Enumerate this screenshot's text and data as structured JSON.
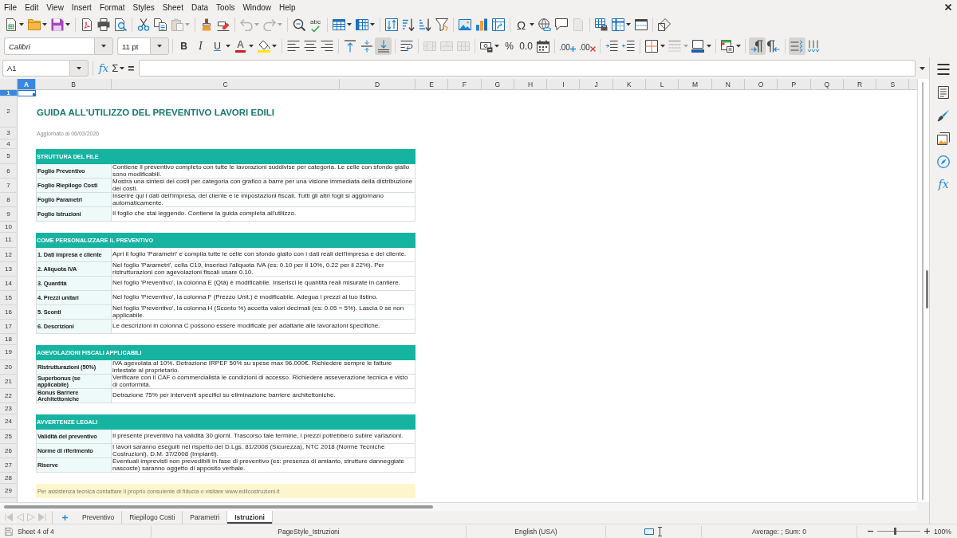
{
  "menu_bar": {
    "items": [
      "File",
      "Edit",
      "View",
      "Insert",
      "Format",
      "Styles",
      "Sheet",
      "Data",
      "Tools",
      "Window",
      "Help"
    ]
  },
  "standard_toolbar": {
    "spelling_label": "abc",
    "special_character_label": "Ω",
    "paste": {
      "disabled": true
    },
    "undo": {
      "disabled": true
    },
    "redo": {
      "disabled": true
    },
    "headers_footers": {
      "disabled": true
    }
  },
  "formatting_toolbar": {
    "font_name": "Calibri",
    "font_size": "11 pt",
    "bold_label": "B",
    "italic_label": "I",
    "underline_label": "U",
    "font_color_label": "A",
    "percent_label": "%",
    "number_label": "0.0",
    "add_decimal_label": ".00",
    "delete_decimal_label": ".00",
    "vertical_align": [
      {
        "selected": false
      },
      {
        "selected": false
      },
      {
        "selected": true
      }
    ],
    "merge_buttons": [
      {
        "disabled": true
      },
      {
        "disabled": true
      },
      {
        "disabled": true
      }
    ],
    "border_style": {
      "disabled": true
    },
    "paragraph_direction": [
      {
        "selected": true
      },
      {
        "selected": false
      }
    ],
    "text_orientation": [
      {
        "selected": true
      },
      {
        "selected": false
      }
    ]
  },
  "formula_bar": {
    "cell_reference": "A1",
    "function_wizard_label": "fx",
    "sum_label": "Σ",
    "formula_label": "="
  },
  "sidebar": {
    "functions_label": "fx"
  },
  "column_headers": [
    {
      "label": "A",
      "selected": true
    },
    {
      "label": "B",
      "selected": false
    },
    {
      "label": "C",
      "selected": false
    },
    {
      "label": "D",
      "selected": false
    },
    {
      "label": "E",
      "selected": false
    },
    {
      "label": "F",
      "selected": false
    },
    {
      "label": "G",
      "selected": false
    },
    {
      "label": "H",
      "selected": false
    },
    {
      "label": "I",
      "selected": false
    },
    {
      "label": "J",
      "selected": false
    },
    {
      "label": "K",
      "selected": false
    },
    {
      "label": "L",
      "selected": false
    },
    {
      "label": "M",
      "selected": false
    },
    {
      "label": "N",
      "selected": false
    },
    {
      "label": "O",
      "selected": false
    },
    {
      "label": "P",
      "selected": false
    },
    {
      "label": "Q",
      "selected": false
    },
    {
      "label": "R",
      "selected": false
    },
    {
      "label": "S",
      "selected": false
    }
  ],
  "row_headers": [
    {
      "label": "1",
      "selected": true
    },
    {
      "label": "2",
      "selected": false
    },
    {
      "label": "3",
      "selected": false
    },
    {
      "label": "4",
      "selected": false
    },
    {
      "label": "5",
      "selected": false
    },
    {
      "label": "6",
      "selected": false
    },
    {
      "label": "7",
      "selected": false
    },
    {
      "label": "8",
      "selected": false
    },
    {
      "label": "9",
      "selected": false
    },
    {
      "label": "10",
      "selected": false
    },
    {
      "label": "11",
      "selected": false
    },
    {
      "label": "12",
      "selected": false
    },
    {
      "label": "13",
      "selected": false
    },
    {
      "label": "14",
      "selected": false
    },
    {
      "label": "15",
      "selected": false
    },
    {
      "label": "16",
      "selected": false
    },
    {
      "label": "17",
      "selected": false
    },
    {
      "label": "18",
      "selected": false
    },
    {
      "label": "19",
      "selected": false
    },
    {
      "label": "20",
      "selected": false
    },
    {
      "label": "21",
      "selected": false
    },
    {
      "label": "22",
      "selected": false
    },
    {
      "label": "23",
      "selected": false
    },
    {
      "label": "24",
      "selected": false
    },
    {
      "label": "25",
      "selected": false
    },
    {
      "label": "26",
      "selected": false
    },
    {
      "label": "27",
      "selected": false
    },
    {
      "label": "28",
      "selected": false
    },
    {
      "label": "29",
      "selected": false
    }
  ],
  "sheet": {
    "title": "GUIDA ALL'UTILIZZO DEL PREVENTIVO LAVORI EDILI",
    "updated": "Aggiornato al 06/03/2026",
    "sections": [
      {
        "heading": "STRUTTURA DEL FILE",
        "rows": [
          {
            "label": "Foglio Preventivo",
            "text": "Contiene il preventivo completo con tutte le lavorazioni suddivise per categoria. Le celle con sfondo giallo sono modificabili."
          },
          {
            "label": "Foglio Riepilogo Costi",
            "text": "Mostra una sintesi dei costi per categoria con grafico a barre per una visione immediata della distribuzione dei costi."
          },
          {
            "label": "Foglio Parametri",
            "text": "Inserire qui i dati dell'impresa, del cliente e le impostazioni fiscali. Tutti gli altri fogli si aggiornano automaticamente."
          },
          {
            "label": "Foglio Istruzioni",
            "text": "Il foglio che stai leggendo. Contiene la guida completa all'utilizzo."
          }
        ]
      },
      {
        "heading": "COME PERSONALIZZARE IL PREVENTIVO",
        "rows": [
          {
            "label": "1. Dati impresa e cliente",
            "text": "Apri il foglio 'Parametri' e compila tutte le celle con sfondo giallo con i dati reali dell'impresa e del cliente."
          },
          {
            "label": "2. Aliquota IVA",
            "text": "Nel foglio 'Parametri', cella C19, inserisci l'aliquota IVA (es: 0.10 per il 10%, 0.22 per il 22%). Per ristrutturazioni con agevolazioni fiscali usare 0.10."
          },
          {
            "label": "3. Quantità",
            "text": "Nel foglio 'Preventivo', la colonna E (Qtà) è modificabile. Inserisci le quantità reali misurate in cantiere."
          },
          {
            "label": "4. Prezzi unitari",
            "text": "Nel foglio 'Preventivo', la colonna F (Prezzo Unit.) è modificabile. Adegua i prezzi al tuo listino."
          },
          {
            "label": "5. Sconti",
            "text": "Nel foglio 'Preventivo', la colonna H (Sconto %) accetta valori decimali (es: 0.05 = 5%). Lascia 0 se non applicabile."
          },
          {
            "label": "6. Descrizioni",
            "text": "Le descrizioni in colonna C possono essere modificate per adattarle alle lavorazioni specifiche."
          }
        ]
      },
      {
        "heading": "AGEVOLAZIONI FISCALI APPLICABILI",
        "rows": [
          {
            "label": "Ristrutturazioni (50%)",
            "text": "IVA agevolata al 10%. Detrazione IRPEF 50% su spese max 96.000€. Richiedere sempre le fatture intestate al proprietario."
          },
          {
            "label": "Superbonus (se applicabile)",
            "text": "Verificare con il CAF o commercialista le condizioni di accesso. Richiedere asseverazione tecnica e visto di conformità."
          },
          {
            "label": "Bonus Barriere Architettoniche",
            "text": "Detrazione 75% per interventi specifici su eliminazione barriere architettoniche."
          }
        ]
      },
      {
        "heading": "AVVERTENZE LEGALI",
        "rows": [
          {
            "label": "Validità del preventivo",
            "text": "Il presente preventivo ha validità 30 giorni. Trascorso tale termine, i prezzi potrebbero subire variazioni."
          },
          {
            "label": "Norme di riferimento",
            "text": "I lavori saranno eseguiti nel rispetto del D.Lgs. 81/2008 (Sicurezza), NTC 2018 (Norme Tecniche Costruzioni), D.M. 37/2008 (Impianti)."
          },
          {
            "label": "Riserve",
            "text": "Eventuali imprevisti non prevedibili in fase di preventivo (es: presenza di amianto, strutture danneggiate nascoste) saranno oggetto di apposito verbale."
          }
        ]
      }
    ],
    "footer_note": "Per assistenza tecnica contattare il proprio consulente di fiducia o visitare www.edilcostruzioni.it"
  },
  "sheet_navigation": {
    "disabled": true
  },
  "sheet_tabs": [
    {
      "label": "Preventivo",
      "selected": false
    },
    {
      "label": "Riepilogo Costi",
      "selected": false
    },
    {
      "label": "Parametri",
      "selected": false
    },
    {
      "label": "Istruzioni",
      "selected": true
    }
  ],
  "status_bar": {
    "sheet_position": "Sheet 4 of 4",
    "page_style": "PageStyle_Istruzioni",
    "language": "English (USA)",
    "selection_summary": "Average: ; Sum: 0",
    "zoom": {
      "level": 0.4,
      "reading": "100%"
    }
  }
}
